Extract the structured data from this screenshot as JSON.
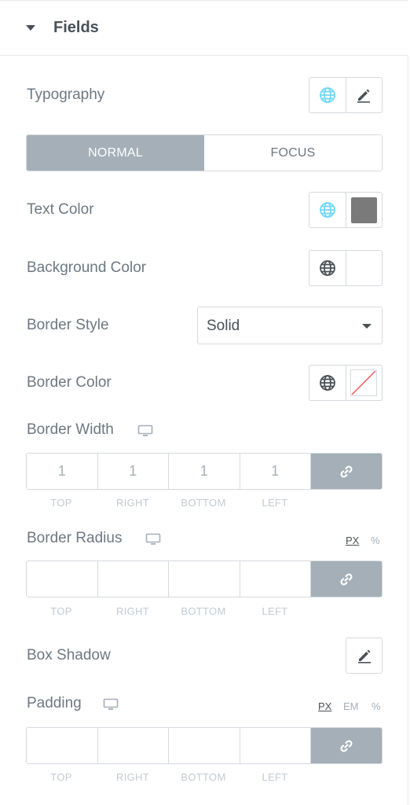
{
  "section": {
    "title": "Fields"
  },
  "typography": {
    "label": "Typography"
  },
  "tabs": [
    {
      "label": "NORMAL",
      "active": true
    },
    {
      "label": "FOCUS",
      "active": false
    }
  ],
  "text_color": {
    "label": "Text Color",
    "swatch": "#7a7a7a"
  },
  "background_color": {
    "label": "Background Color"
  },
  "border_style": {
    "label": "Border Style",
    "value": "Solid"
  },
  "border_color": {
    "label": "Border Color"
  },
  "border_width": {
    "label": "Border Width",
    "values": [
      "1",
      "1",
      "1",
      "1"
    ],
    "sides": [
      "TOP",
      "RIGHT",
      "BOTTOM",
      "LEFT"
    ]
  },
  "border_radius": {
    "label": "Border Radius",
    "units": [
      "PX",
      "%"
    ],
    "active_unit": "PX",
    "values": [
      "",
      "",
      "",
      ""
    ],
    "sides": [
      "TOP",
      "RIGHT",
      "BOTTOM",
      "LEFT"
    ]
  },
  "box_shadow": {
    "label": "Box Shadow"
  },
  "padding": {
    "label": "Padding",
    "units": [
      "PX",
      "EM",
      "%"
    ],
    "active_unit": "PX",
    "values": [
      "",
      "",
      "",
      ""
    ],
    "sides": [
      "TOP",
      "RIGHT",
      "BOTTOM",
      "LEFT"
    ]
  },
  "colors": {
    "globe_active": "#71d7f7",
    "globe_default": "#495157",
    "accent_gray": "#a4afb7",
    "border": "#d5dadf"
  }
}
